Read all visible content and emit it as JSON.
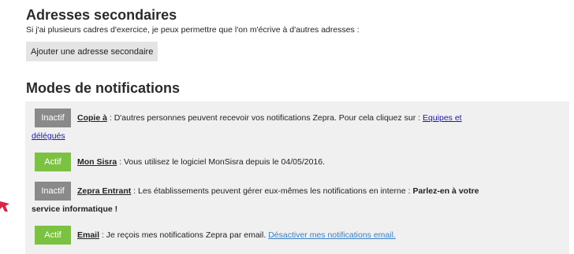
{
  "secondary_addresses": {
    "title": "Adresses secondaires",
    "subtitle": "Si j'ai plusieurs cadres d'exercice, je peux permettre que l'on m'écrive à d'autres adresses :",
    "add_button_label": "Ajouter une adresse secondaire"
  },
  "notifications": {
    "title": "Modes de notifications",
    "rows": [
      {
        "status": "Inactif",
        "name": "Copie à",
        "text": " : D'autres personnes peuvent recevoir vos notifications Zepra. Pour cela cliquez sur : ",
        "link_part1": "Equipes et",
        "link_part2": "délégués"
      },
      {
        "status": "Actif",
        "name": "Mon Sisra",
        "text": " : Vous utilisez le logiciel MonSisra depuis le 04/05/2016."
      },
      {
        "status": "Inactif",
        "name": "Zepra Entrant",
        "text": " : Les établissements peuvent gérer eux-mêmes les notifications en interne : ",
        "strong_part1": "Parlez-en à votre",
        "strong_part2": "service informatique !"
      },
      {
        "status": "Actif",
        "name": "Email",
        "text": " : Je reçois mes notifications Zepra par email. ",
        "link": "Désactiver mes notifications email."
      }
    ]
  },
  "colors": {
    "active": "#7cc242",
    "inactive": "#8a8a8a",
    "panel_background": "#f0f0f0",
    "link": "#1a1aa6",
    "arrow": "#d9254b"
  }
}
